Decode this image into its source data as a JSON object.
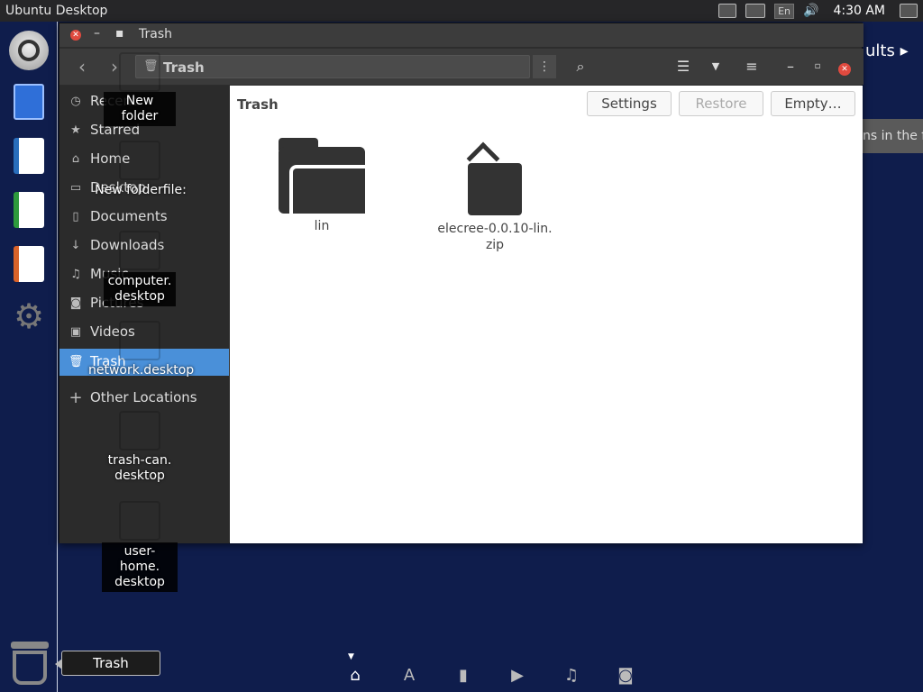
{
  "top_panel": {
    "title": "Ubuntu Desktop",
    "lang": "En",
    "clock": "4:30 AM"
  },
  "desktop_right": {
    "results_text": "ults",
    "hint_text": "ns in the f"
  },
  "window": {
    "title": "Trash",
    "location": "Trash",
    "content_location": "Trash"
  },
  "toolbar": {
    "settings": "Settings",
    "restore": "Restore",
    "empty": "Empty…"
  },
  "sidebar": {
    "items": [
      {
        "label": "Recent",
        "icon": "clock-icon"
      },
      {
        "label": "Starred",
        "icon": "star-icon"
      },
      {
        "label": "Home",
        "icon": "home-icon"
      },
      {
        "label": "Desktop",
        "icon": "folder-icon"
      },
      {
        "label": "Documents",
        "icon": "documents-icon"
      },
      {
        "label": "Downloads",
        "icon": "download-icon"
      },
      {
        "label": "Music",
        "icon": "music-icon"
      },
      {
        "label": "Pictures",
        "icon": "camera-icon"
      },
      {
        "label": "Videos",
        "icon": "video-icon"
      },
      {
        "label": "Trash",
        "icon": "trash-icon"
      },
      {
        "label": "Other Locations",
        "icon": "plus-icon"
      }
    ],
    "active": "Trash"
  },
  "files": [
    {
      "name": "lin",
      "type": "folder"
    },
    {
      "name_line1": "elecree-0.0.10-lin.",
      "name_line2": "zip",
      "type": "archive"
    }
  ],
  "desktop_icons": {
    "new_folder": "New folder",
    "new_folder_file": "New folderfile:",
    "computer_line1": "computer.",
    "computer_line2": "desktop",
    "network": "network.desktop",
    "trash_can_line1": "trash-can.",
    "trash_can_line2": "desktop",
    "user_home_line1": "user-home.",
    "user_home_line2": "desktop"
  },
  "tooltip": "Trash",
  "colors": {
    "desktop_bg": "#0f1d4c",
    "sidebar_active": "#4a90d9",
    "close_red": "#e04a3f"
  }
}
